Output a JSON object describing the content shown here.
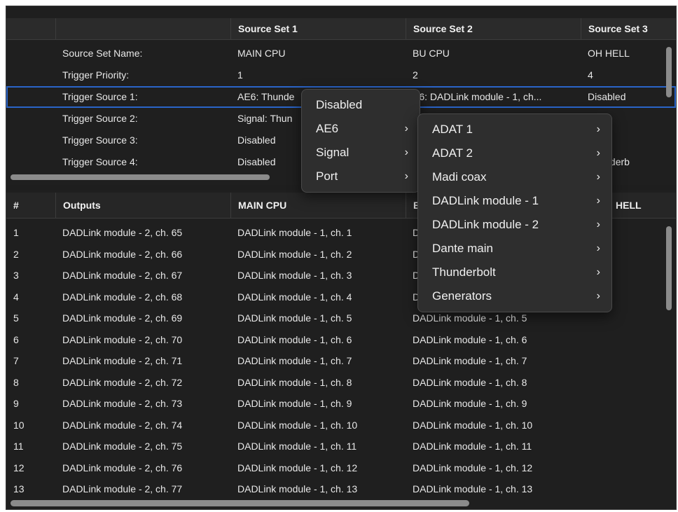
{
  "source_sets": {
    "headers": [
      "",
      "",
      "Source Set 1",
      "Source Set 2",
      "Source Set 3"
    ],
    "rows": [
      [
        "Source Set Name:",
        "MAIN CPU",
        "BU CPU",
        "OH HELL"
      ],
      [
        "Trigger Priority:",
        "1",
        "2",
        "4"
      ],
      [
        "Trigger Source 1:",
        "AE6: Thunde",
        "E6: DADLink module - 1, ch...",
        "Disabled"
      ],
      [
        "Trigger Source 2:",
        "Signal: Thun",
        "",
        "bled"
      ],
      [
        "Trigger Source 3:",
        "Disabled",
        "",
        "bled"
      ],
      [
        "Trigger Source 4:",
        "Disabled",
        "",
        "Thunderb"
      ]
    ]
  },
  "outputs": {
    "headers": [
      "#",
      "Outputs",
      "MAIN CPU",
      "B",
      "HELL"
    ],
    "rows": [
      [
        "1",
        "DADLink module - 2, ch. 65",
        "DADLink module - 1, ch. 1",
        "D"
      ],
      [
        "2",
        "DADLink module - 2, ch. 66",
        "DADLink module - 1, ch. 2",
        "D"
      ],
      [
        "3",
        "DADLink module - 2, ch. 67",
        "DADLink module - 1, ch. 3",
        "D"
      ],
      [
        "4",
        "DADLink module - 2, ch. 68",
        "DADLink module - 1, ch. 4",
        "D"
      ],
      [
        "5",
        "DADLink module - 2, ch. 69",
        "DADLink module - 1, ch. 5",
        "DADLink module - 1, ch. 5"
      ],
      [
        "6",
        "DADLink module - 2, ch. 70",
        "DADLink module - 1, ch. 6",
        "DADLink module - 1, ch. 6"
      ],
      [
        "7",
        "DADLink module - 2, ch. 71",
        "DADLink module - 1, ch. 7",
        "DADLink module - 1, ch. 7"
      ],
      [
        "8",
        "DADLink module - 2, ch. 72",
        "DADLink module - 1, ch. 8",
        "DADLink module - 1, ch. 8"
      ],
      [
        "9",
        "DADLink module - 2, ch. 73",
        "DADLink module - 1, ch. 9",
        "DADLink module - 1, ch. 9"
      ],
      [
        "10",
        "DADLink module - 2, ch. 74",
        "DADLink module - 1, ch. 10",
        "DADLink module - 1, ch. 10"
      ],
      [
        "11",
        "DADLink module - 2, ch. 75",
        "DADLink module - 1, ch. 11",
        "DADLink module - 1, ch. 11"
      ],
      [
        "12",
        "DADLink module - 2, ch. 76",
        "DADLink module - 1, ch. 12",
        "DADLink module - 1, ch. 12"
      ],
      [
        "13",
        "DADLink module - 2, ch. 77",
        "DADLink module - 1, ch. 13",
        "DADLink module - 1, ch. 13"
      ]
    ]
  },
  "context_menu": {
    "items": [
      {
        "label": "Disabled",
        "submenu": false
      },
      {
        "label": "AE6",
        "submenu": true
      },
      {
        "label": "Signal",
        "submenu": true
      },
      {
        "label": "Port",
        "submenu": true
      }
    ]
  },
  "submenu": {
    "items": [
      {
        "label": "ADAT 1",
        "submenu": true
      },
      {
        "label": "ADAT 2",
        "submenu": true
      },
      {
        "label": "Madi coax",
        "submenu": true
      },
      {
        "label": "DADLink module - 1",
        "submenu": true
      },
      {
        "label": "DADLink module - 2",
        "submenu": true
      },
      {
        "label": "Dante main",
        "submenu": true
      },
      {
        "label": "Thunderbolt",
        "submenu": true
      },
      {
        "label": "Generators",
        "submenu": true
      }
    ]
  },
  "colors": {
    "background": "#1f1f1f",
    "header": "#2b2b2b",
    "selection_outline": "#2a64c8",
    "menu": "#2e2e2e"
  },
  "icons": {
    "submenu_chevron": "chevron-right-icon"
  }
}
